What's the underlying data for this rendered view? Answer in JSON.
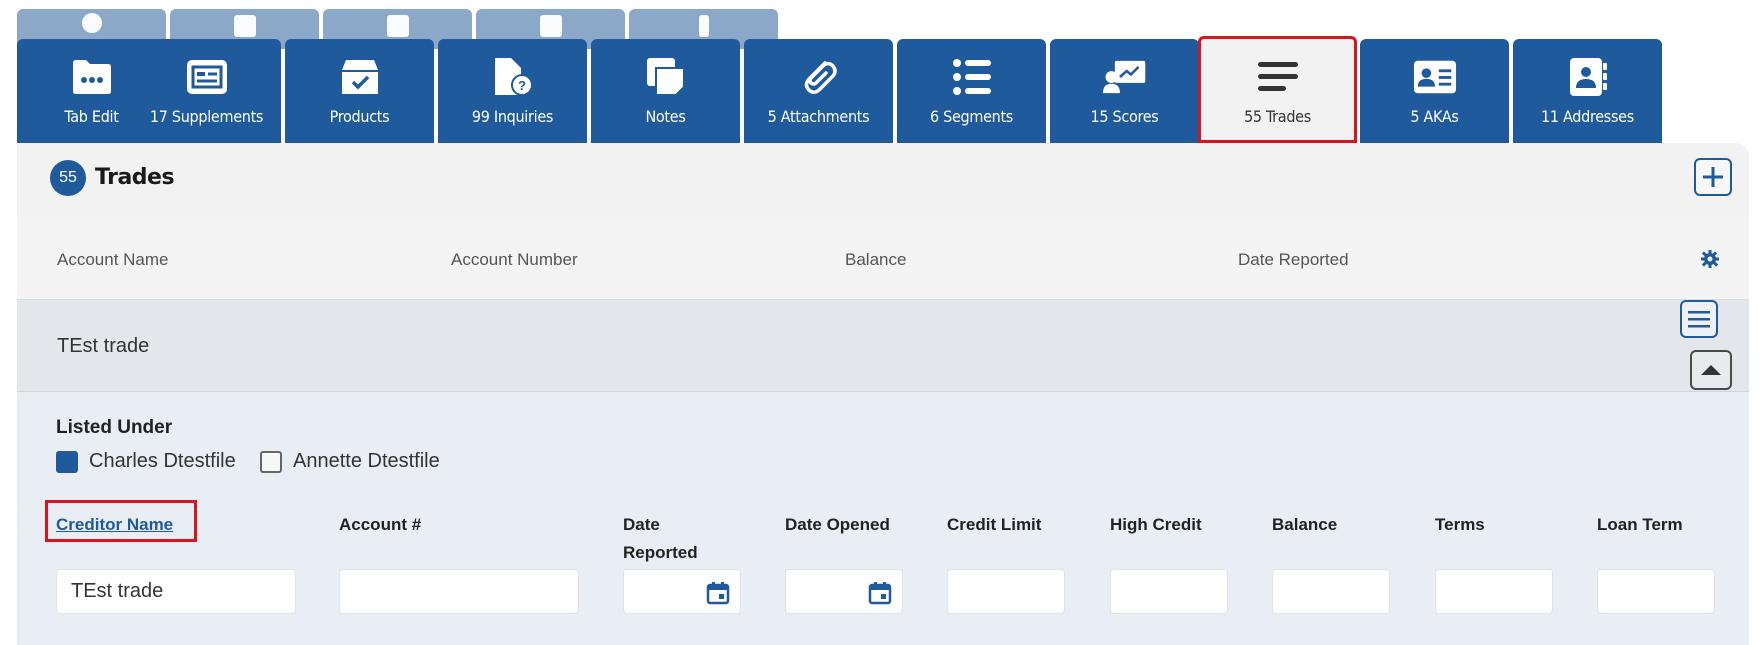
{
  "tabs": [
    {
      "label": "Tab Edit",
      "icon": "folder-icon"
    },
    {
      "label": "17 Supplements",
      "icon": "supplements-icon"
    },
    {
      "label": "Products",
      "icon": "products-box-icon"
    },
    {
      "label": "99 Inquiries",
      "icon": "inquiry-document-icon"
    },
    {
      "label": "Notes",
      "icon": "notes-icon"
    },
    {
      "label": "5 Attachments",
      "icon": "paperclip-icon"
    },
    {
      "label": "6 Segments",
      "icon": "list-icon"
    },
    {
      "label": "15 Scores",
      "icon": "scores-icon"
    },
    {
      "label": "55 Trades",
      "icon": "trades-lines-icon",
      "active": true
    },
    {
      "label": "5 AKAs",
      "icon": "id-card-icon"
    },
    {
      "label": "11 Addresses",
      "icon": "address-book-icon"
    }
  ],
  "panel": {
    "count": "55",
    "title": "Trades",
    "columns": [
      "Account Name",
      "Account Number",
      "Balance",
      "Date Reported"
    ],
    "row": {
      "account_name": "TEst trade"
    }
  },
  "detail": {
    "listed_under_label": "Listed Under",
    "people": [
      {
        "name": "Charles Dtestfile",
        "checked": true
      },
      {
        "name": "Annette Dtestfile",
        "checked": false
      }
    ],
    "fields": {
      "creditor_name": {
        "label": "Creditor Name",
        "value": "TEst trade"
      },
      "account_number": {
        "label": "Account #",
        "value": ""
      },
      "date_reported": {
        "label_line1": "Date",
        "label_line2": "Reported",
        "value": ""
      },
      "date_opened": {
        "label": "Date Opened",
        "value": ""
      },
      "credit_limit": {
        "label": "Credit Limit",
        "value": ""
      },
      "high_credit": {
        "label": "High Credit",
        "value": ""
      },
      "balance": {
        "label": "Balance",
        "value": ""
      },
      "terms": {
        "label": "Terms",
        "value": ""
      },
      "loan_term": {
        "label": "Loan Term",
        "value": ""
      }
    }
  },
  "colors": {
    "primary": "#1e5a9c",
    "highlight": "#d9141d",
    "back_tab": "#8ba8c9"
  }
}
